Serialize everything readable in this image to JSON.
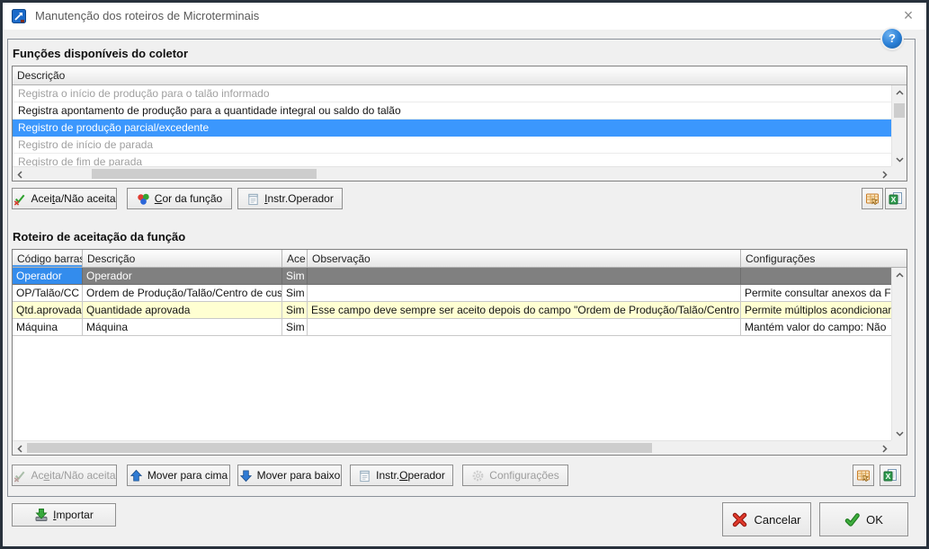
{
  "window": {
    "title": "Manutenção dos roteiros de Microterminais",
    "close_glyph": "×"
  },
  "help": {
    "glyph": "?"
  },
  "functions_list": {
    "section_title": "Funções disponíveis do coletor",
    "header": "Descrição",
    "rows": [
      {
        "text": "Registra o início de produção para o talão informado",
        "state": "disabled"
      },
      {
        "text": "Registra apontamento de produção para a quantidade integral ou saldo do talão",
        "state": "normal"
      },
      {
        "text": "Registro de produção parcial/excedente",
        "state": "selected"
      },
      {
        "text": "Registro de início de parada",
        "state": "disabled"
      },
      {
        "text": "Registro de fim de parada",
        "state": "disabled"
      }
    ]
  },
  "functions_buttons": {
    "aceita": {
      "pre": "Acei",
      "accel": "t",
      "post": "a/Não aceita"
    },
    "cor": {
      "pre": "",
      "accel": "C",
      "post": "or da função"
    },
    "instr": {
      "pre": "",
      "accel": "I",
      "post": "nstr.Operador"
    }
  },
  "roteiro_table": {
    "section_title": "Roteiro de aceitação da função",
    "columns": {
      "codigo": "Código barras",
      "descricao": "Descrição",
      "ace": "Ace",
      "observacao": "Observação",
      "configuracoes": "Configurações"
    },
    "rows": [
      {
        "codigo": "Operador",
        "descricao": "Operador",
        "ace": "Sim",
        "observacao": "",
        "configuracoes": "",
        "state": "selected"
      },
      {
        "codigo": "OP/Talão/CC",
        "descricao": "Ordem de Produção/Talão/Centro de custo",
        "ace": "Sim",
        "observacao": "",
        "configuracoes": "Permite consultar anexos da Form",
        "state": "normal"
      },
      {
        "codigo": "Qtd.aprovada",
        "descricao": "Quantidade aprovada",
        "ace": "Sim",
        "observacao": "Esse campo deve sempre ser aceito depois do campo \"Ordem de Produção/Talão/Centro de custo\"",
        "configuracoes": "Permite múltiplos acondicionament",
        "state": "highlight"
      },
      {
        "codigo": "Máquina",
        "descricao": "Máquina",
        "ace": "Sim",
        "observacao": "",
        "configuracoes": "Mantém valor do campo: Não",
        "state": "normal"
      }
    ]
  },
  "roteiro_buttons": {
    "aceita": {
      "pre": "Ac",
      "accel": "e",
      "post": "ita/Não aceita"
    },
    "mover_cima": "Mover para cima",
    "mover_baixo": "Mover para baixo",
    "instr": {
      "pre": "Instr.",
      "accel": "O",
      "post": "perador"
    },
    "config": {
      "pre": "Confi",
      "accel": "g",
      "post": "urações"
    }
  },
  "footer": {
    "importar": {
      "pre": "",
      "accel": "I",
      "post": "mportar"
    },
    "cancelar": "Cancelar",
    "ok": "OK"
  },
  "colors": {
    "selection_blue": "#3b97fd",
    "selected_cell_blue": "#338ced",
    "selected_row_gray": "#808080",
    "row_yellow": "#ffffd2",
    "titlebar_bg": "#ffffff",
    "body_bg": "#f0f0f0",
    "help_blue": "#2a7fd6",
    "ok_green": "#3fae3f",
    "cancel_red": "#d8352a",
    "window_border": "#28313c"
  }
}
